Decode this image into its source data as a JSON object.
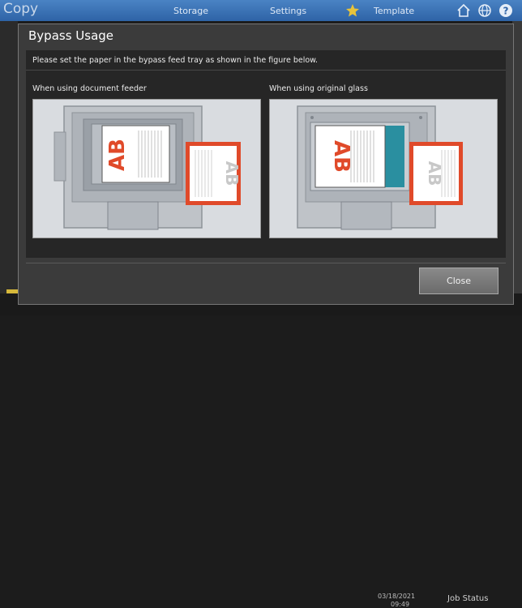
{
  "app": {
    "title": "Copy",
    "nav": {
      "storage": "Storage",
      "settings": "Settings",
      "template": "Template"
    }
  },
  "status": {
    "date": "03/18/2021",
    "time": "09:49",
    "job_status": "Job Status"
  },
  "dialog": {
    "title": "Bypass Usage",
    "instruction": "Please set the paper in the bypass feed tray as shown in the figure below.",
    "left_label": "When using document feeder",
    "right_label": "When using original glass",
    "close_label": "Close"
  },
  "figure": {
    "text_ab": "AB"
  },
  "colors": {
    "topbar": "#3c74b8",
    "dialog": "#3b3b3b",
    "panel": "#d9dce0",
    "accent_red": "#e04a2a",
    "glass_teal": "#2a8fa0"
  }
}
